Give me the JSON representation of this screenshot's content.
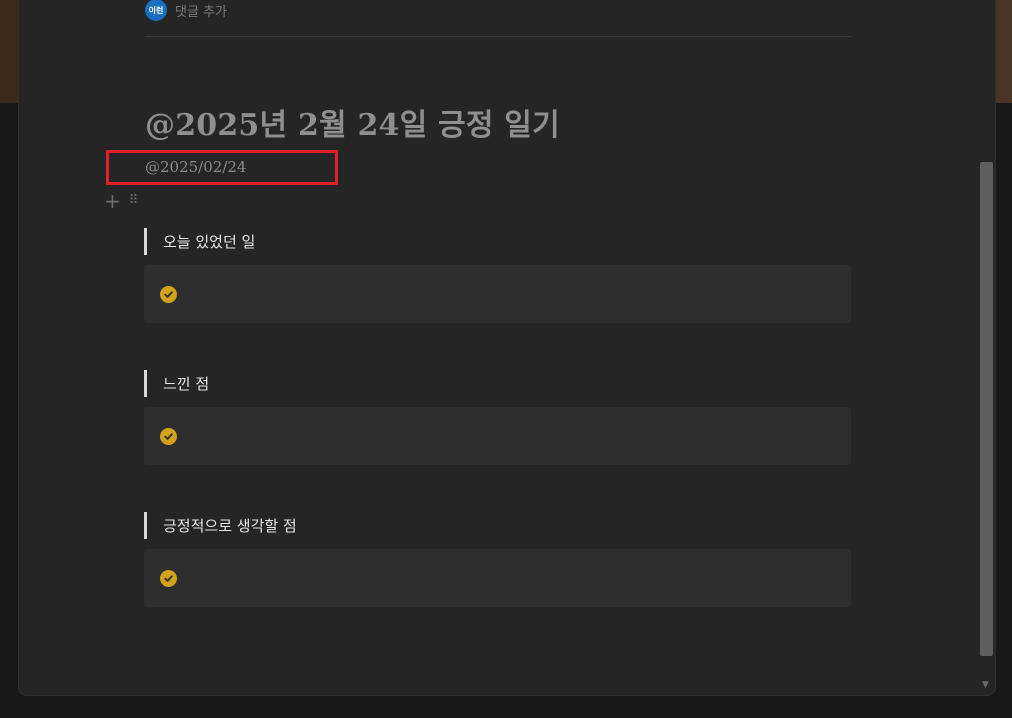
{
  "header": {
    "avatar_text": "이런",
    "comment_add_label": "댓글 추가"
  },
  "page": {
    "title": "@2025년 2월 24일 긍정 일기",
    "date": "@2025/02/24"
  },
  "block_tools": {
    "plus_glyph": "+",
    "drag_glyph": "⠿"
  },
  "sections": [
    {
      "heading": "오늘 있었던 일",
      "icon": "check-circle-icon"
    },
    {
      "heading": "느낀 점",
      "icon": "check-circle-icon"
    },
    {
      "heading": "긍정적으로 생각할 점",
      "icon": "check-circle-icon"
    }
  ],
  "colors": {
    "accent_check": "#d3a11a",
    "highlight_box": "#e0202a",
    "avatar_blue": "#1c6fc0"
  }
}
